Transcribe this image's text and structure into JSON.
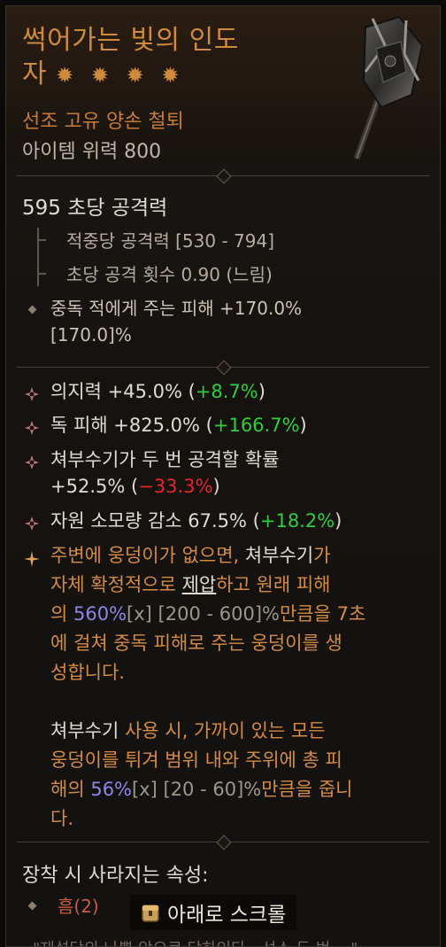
{
  "item": {
    "name_line1": "썩어가는 빛의 인도",
    "name_line2": "자",
    "rarity_stars": "✹ ✹ ✹ ✹",
    "type": "선조 고유 양손 철퇴",
    "item_power": "아이템 위력 800"
  },
  "weapon_stats": {
    "dps": "595 초당 공격력",
    "damage_per_hit": "적중당 공격력 [530 - 794]",
    "attacks_per_second": "초당 공격 횟수 0.90 (느림)",
    "implicit_line1": "중독 적에게 주는 피해 +170.0%",
    "implicit_line2": "[170.0]%"
  },
  "affixes": [
    {
      "text": "의지력 +45.0% (",
      "delta": "+8.7%",
      "delta_color": "green",
      "close": ")"
    },
    {
      "text": "독 피해 +825.0% (",
      "delta": "+166.7%",
      "delta_color": "green",
      "close": ")"
    },
    {
      "text_line1": "쳐부수기가 두 번 공격할 확률",
      "text": "+52.5% (",
      "delta": "−33.3%",
      "delta_color": "red",
      "close": ")"
    },
    {
      "text": "자원 소모량 감소 67.5% (",
      "delta": "+18.2%",
      "delta_color": "green",
      "close": ")"
    }
  ],
  "legendary": {
    "p1_a": "주변에 웅덩이가 없으면, ",
    "p1_skill": "쳐부수기",
    "p1_b": "가",
    "p1_c": "자체 확정적으로 ",
    "p1_underline": "제압",
    "p1_d": "하고 원래 피해",
    "p1_e": "의 ",
    "p1_value": "560%",
    "p1_range": "[x] [200 - 600]%",
    "p1_f": "만큼을 7초",
    "p1_g": "에 걸쳐 중독 피해로 주는 웅덩이를 생",
    "p1_h": "성합니다.",
    "p2_skill": "쳐부수기",
    "p2_a": " 사용 시, 가까이 있는 모든",
    "p2_b": "웅덩이를 튀겨 범위 내와 주위에 총 피",
    "p2_c": "해의 ",
    "p2_value": "56%",
    "p2_range": "[x] [20 - 60]%",
    "p2_d": "만큼을 줍니",
    "p2_e": "다."
  },
  "unequip": {
    "title": "장착 시 사라지는 속성:",
    "item": "흠(2)"
  },
  "scroll_hint": "아래로 스크롤",
  "flavor_text": "\"재설당의 나쁜 악으로 당하인다 - 선스 두 번 ...\"",
  "colors": {
    "legendary_orange": "#cf8a3d",
    "green": "#2ecf3b",
    "red": "#e8252b",
    "blue_value": "#8b86e8"
  }
}
